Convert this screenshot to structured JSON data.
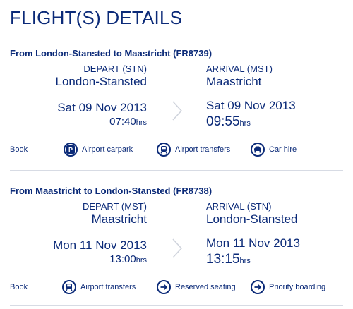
{
  "page": {
    "title": "FLIGHT(S) DETAILS"
  },
  "flights": [
    {
      "header": "From London-Stansted to Maastricht (FR8739)",
      "depart": {
        "code_label": "DEPART (STN)",
        "city": "London-Stansted",
        "date": "Sat 09 Nov 2013",
        "time": "07:40",
        "unit": "hrs"
      },
      "arrival": {
        "code_label": "ARRIVAL (MST)",
        "city": "Maastricht",
        "date": "Sat 09 Nov 2013",
        "time": "09:55",
        "unit": "hrs"
      },
      "book_label": "Book",
      "extras": [
        {
          "label": "Airport carpark",
          "icon": "parking-icon"
        },
        {
          "label": "Airport transfers",
          "icon": "bus-icon"
        },
        {
          "label": "Car hire",
          "icon": "car-icon"
        }
      ]
    },
    {
      "header": "From Maastricht to London-Stansted (FR8738)",
      "depart": {
        "code_label": "DEPART (MST)",
        "city": "Maastricht",
        "date": "Mon 11 Nov 2013",
        "time": "13:00",
        "unit": "hrs"
      },
      "arrival": {
        "code_label": "ARRIVAL (STN)",
        "city": "London-Stansted",
        "date": "Mon 11 Nov 2013",
        "time": "13:15",
        "unit": "hrs"
      },
      "book_label": "Book",
      "extras": [
        {
          "label": "Airport transfers",
          "icon": "bus-icon"
        },
        {
          "label": "Reserved seating",
          "icon": "arrow-right-icon"
        },
        {
          "label": "Priority boarding",
          "icon": "arrow-right-icon"
        }
      ]
    }
  ],
  "colors": {
    "primary": "#0b2a78",
    "divider": "#d7dbe4",
    "chevron": "#cfd3dc"
  }
}
